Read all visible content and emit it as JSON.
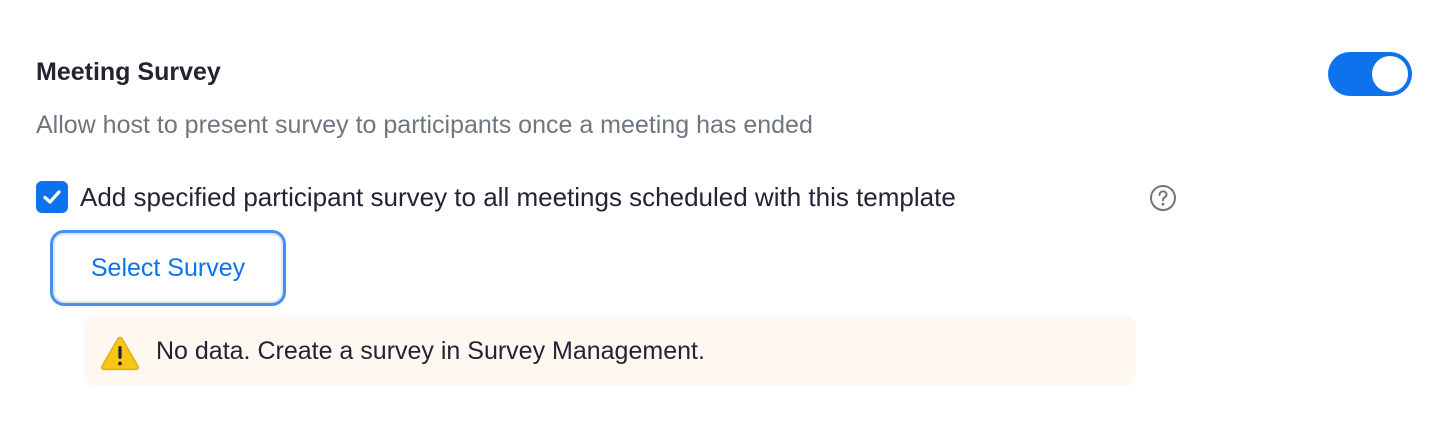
{
  "setting": {
    "title": "Meeting Survey",
    "description": "Allow host to present survey to participants once a meeting has ended",
    "enabled": true
  },
  "checkbox": {
    "checked": true,
    "label": "Add specified participant survey to all meetings scheduled with this template",
    "help_icon": "question-circle-icon"
  },
  "select_survey_button": {
    "label": "Select Survey"
  },
  "warning": {
    "icon": "warning-triangle-icon",
    "message": "No data. Create a survey in Survey Management."
  },
  "colors": {
    "accent": "#0e72ed",
    "warning_background": "#fef8f0",
    "warning_icon": "#f5c518",
    "muted_text": "#6e7680"
  }
}
